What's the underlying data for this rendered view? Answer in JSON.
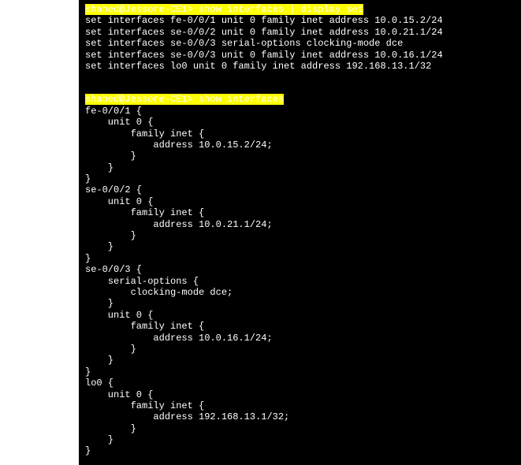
{
  "block1": {
    "prompt": "shahed@Jessore-CE1> show interfaces | display set",
    "lines": [
      "set interfaces fe-0/0/1 unit 0 family inet address 10.0.15.2/24",
      "set interfaces se-0/0/2 unit 0 family inet address 10.0.21.1/24",
      "set interfaces se-0/0/3 serial-options clocking-mode dce",
      "set interfaces se-0/0/3 unit 0 family inet address 10.0.16.1/24",
      "set interfaces lo0 unit 0 family inet address 192.168.13.1/32"
    ]
  },
  "block2": {
    "prompt": "shahed@Jessore-CE1> show interfaces",
    "lines": [
      "fe-0/0/1 {",
      "    unit 0 {",
      "        family inet {",
      "            address 10.0.15.2/24;",
      "        }",
      "    }",
      "}",
      "se-0/0/2 {",
      "    unit 0 {",
      "        family inet {",
      "            address 10.0.21.1/24;",
      "        }",
      "    }",
      "}",
      "se-0/0/3 {",
      "    serial-options {",
      "        clocking-mode dce;",
      "    }",
      "    unit 0 {",
      "        family inet {",
      "            address 10.0.16.1/24;",
      "        }",
      "    }",
      "}",
      "lo0 {",
      "    unit 0 {",
      "        family inet {",
      "            address 192.168.13.1/32;",
      "        }",
      "    }",
      "}"
    ]
  }
}
